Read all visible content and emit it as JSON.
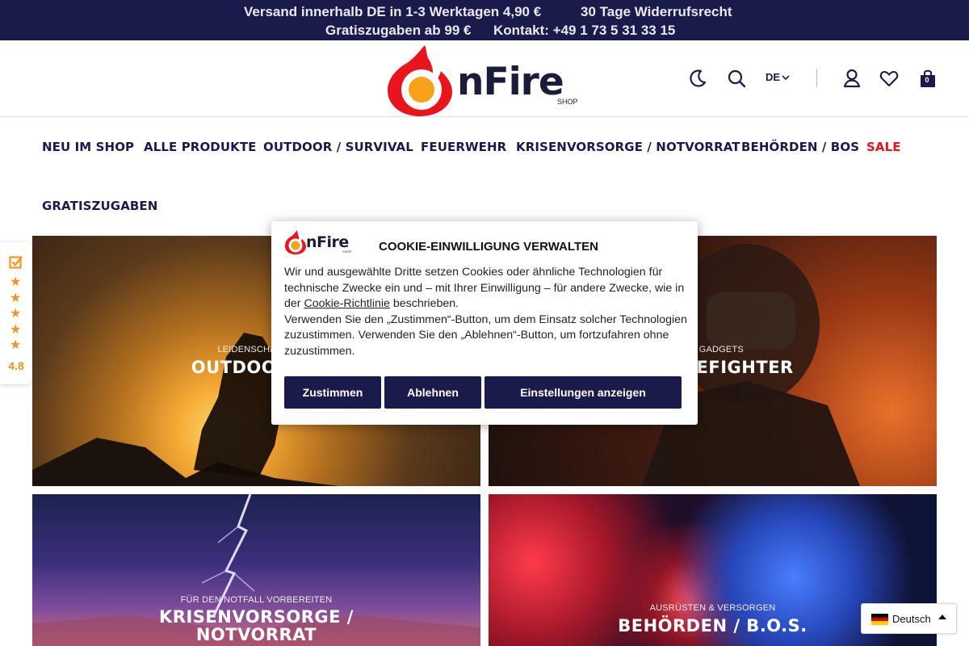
{
  "topbar": {
    "shipping": "Versand innerhalb DE in 1-3 Werktagen 4,90 €",
    "returns": "30 Tage Widerrufsrecht",
    "gifts": "Gratiszugaben ab 99 €",
    "contact": "Kontakt: +49 1 73 5 31 33 15"
  },
  "header": {
    "logo_word": "nFire",
    "logo_shop": "SHOP",
    "language": "DE",
    "cart_count": "0",
    "icons": [
      "moon-icon",
      "search-icon",
      "chevron-down-icon",
      "user-icon",
      "heart-icon",
      "bag-icon"
    ]
  },
  "nav": {
    "items": [
      {
        "label": "NEU IM SHOP"
      },
      {
        "label": "ALLE PRODUKTE"
      },
      {
        "label": "OUTDOOR / SURVIVAL"
      },
      {
        "label": "FEUERWEHR"
      },
      {
        "label": "KRISENVORSORGE / NOTVORRAT"
      },
      {
        "label": "BEHÖRDEN / BOS"
      },
      {
        "label": "SALE"
      },
      {
        "label": "GRATISZUGABEN"
      }
    ],
    "sale_color": "#e8151e"
  },
  "tiles": [
    {
      "subtitle": "LEIDENSCHAFT A",
      "title": "OUTDOOR / S"
    },
    {
      "subtitle": "S & GADGETS",
      "title": "R / FIREFIGHTER"
    },
    {
      "subtitle": "FÜR DEN NOTFALL VORBEREITEN",
      "title_line1": "KRISENVORSORGE /",
      "title_line2": "NOTVORRAT"
    },
    {
      "subtitle": "AUSRÜSTEN & VERSORGEN",
      "title": "BEHÖRDEN / B.O.S."
    }
  ],
  "rating": {
    "score": "4.8",
    "stars": 5,
    "star_color": "#f39321"
  },
  "cookie": {
    "logo_word": "nFire",
    "logo_shop": "SHOP",
    "title": "COOKIE-EINWILLIGUNG VERWALTEN",
    "text_part1": "Wir und ausgewählte Dritte setzen Cookies oder ähnliche Technologien für technische Zwecke ein und – mit Ihrer Einwilligung – für andere Zwecke, wie in der ",
    "link": "Cookie-Richtlinie",
    "text_part2": " beschrieben.",
    "text_part3": "Verwenden Sie den „Zustimmen“-Button, um dem Einsatz solcher Technologien zuzustimmen. Verwenden Sie den „Ablehnen“-Button, um fortzufahren ohne zuzustimmen.",
    "accept": "Zustimmen",
    "reject": "Ablehnen",
    "settings": "Einstellungen anzeigen"
  },
  "language_switcher": {
    "label": "Deutsch"
  },
  "colors": {
    "navy": "#1b1b4b",
    "brand_red": "#e8151e",
    "brand_orange": "#f39321"
  }
}
